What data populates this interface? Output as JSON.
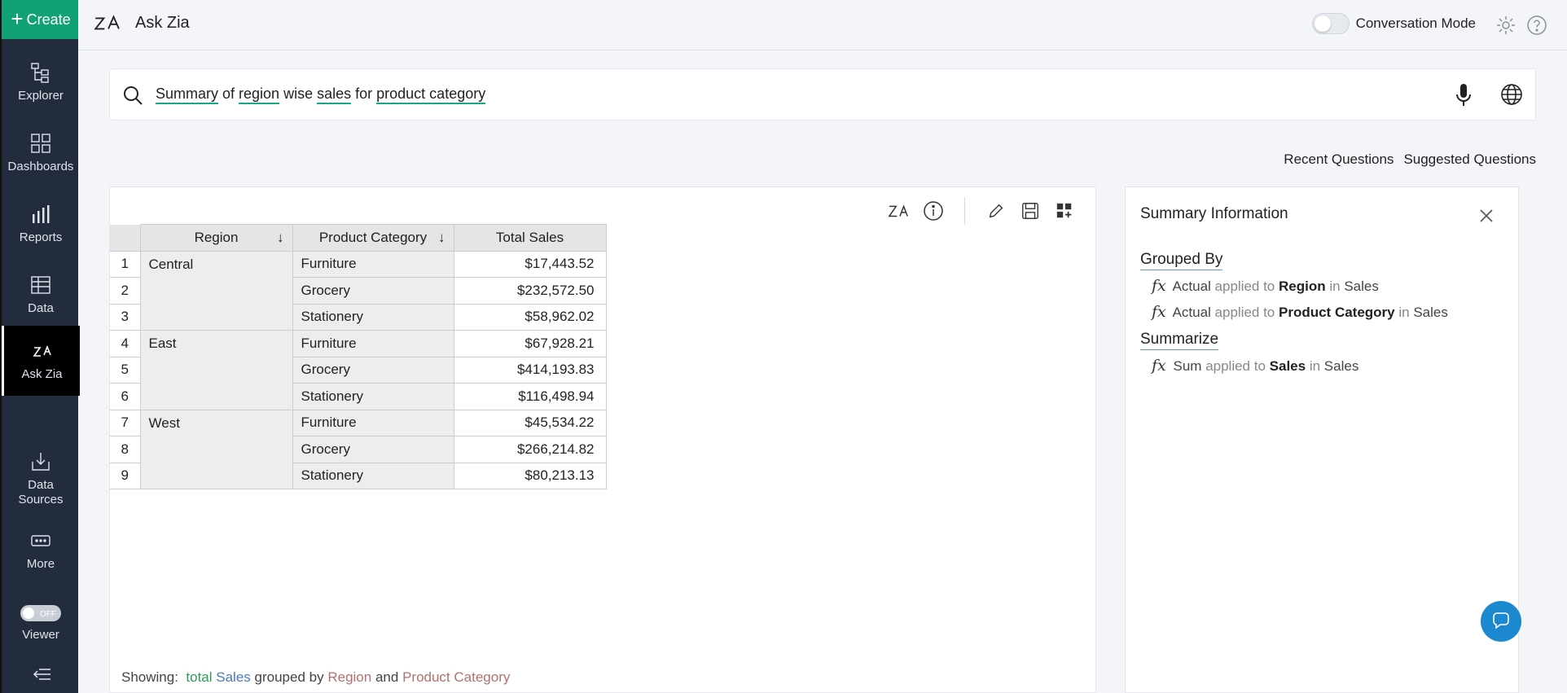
{
  "sidebar": {
    "create_label": "Create",
    "items": [
      {
        "label": "Explorer",
        "icon": "explorer-icon"
      },
      {
        "label": "Dashboards",
        "icon": "dashboards-icon"
      },
      {
        "label": "Reports",
        "icon": "reports-icon"
      },
      {
        "label": "Data",
        "icon": "data-icon"
      },
      {
        "label": "Ask Zia",
        "icon": "zia-icon",
        "active": true
      },
      {
        "label": "Data\nSources",
        "icon": "data-sources-icon"
      },
      {
        "label": "More",
        "icon": "more-icon"
      },
      {
        "label": "Viewer",
        "icon": "viewer-toggle",
        "toggle_text": "OFF"
      }
    ]
  },
  "header": {
    "title": "Ask Zia",
    "conversation_mode_label": "Conversation Mode"
  },
  "search": {
    "tokens": [
      {
        "text": "Summary",
        "underlined": true
      },
      {
        "text": " of ",
        "underlined": false
      },
      {
        "text": "region",
        "underlined": true
      },
      {
        "text": " wise ",
        "underlined": false
      },
      {
        "text": "sales",
        "underlined": true
      },
      {
        "text": " for ",
        "underlined": false
      },
      {
        "text": "product category",
        "underlined": true
      }
    ]
  },
  "links": {
    "recent": "Recent Questions",
    "suggested": "Suggested Questions"
  },
  "table": {
    "headers": [
      "Region",
      "Product Category",
      "Total Sales"
    ],
    "groups": [
      {
        "region": "Central",
        "rows": [
          {
            "num": "1",
            "category": "Furniture",
            "total": "$17,443.52"
          },
          {
            "num": "2",
            "category": "Grocery",
            "total": "$232,572.50"
          },
          {
            "num": "3",
            "category": "Stationery",
            "total": "$58,962.02"
          }
        ]
      },
      {
        "region": "East",
        "rows": [
          {
            "num": "4",
            "category": "Furniture",
            "total": "$67,928.21"
          },
          {
            "num": "5",
            "category": "Grocery",
            "total": "$414,193.83"
          },
          {
            "num": "6",
            "category": "Stationery",
            "total": "$116,498.94"
          }
        ]
      },
      {
        "region": "West",
        "rows": [
          {
            "num": "7",
            "category": "Furniture",
            "total": "$45,534.22"
          },
          {
            "num": "8",
            "category": "Grocery",
            "total": "$266,214.82"
          },
          {
            "num": "9",
            "category": "Stationery",
            "total": "$80,213.13"
          }
        ]
      }
    ]
  },
  "showing": {
    "prefix": "Showing:",
    "w1": "total",
    "w2": "Sales",
    "w3": "grouped by",
    "w4": "Region",
    "w5": "and",
    "w6": "Product Category"
  },
  "summary": {
    "title": "Summary Information",
    "grouped_by_label": "Grouped By",
    "summarize_label": "Summarize",
    "fx": "fx",
    "lines": [
      {
        "func": "Actual",
        "applied": "applied to",
        "field": "Region",
        "in": "in",
        "table": "Sales"
      },
      {
        "func": "Actual",
        "applied": "applied to",
        "field": "Product Category",
        "in": "in",
        "table": "Sales"
      },
      {
        "func": "Sum",
        "applied": "applied to",
        "field": "Sales",
        "in": "in",
        "table": "Sales"
      }
    ]
  },
  "colors": {
    "accent_green": "#12a176",
    "sidebar_bg": "#232c3d",
    "fab_blue": "#1b88d0"
  }
}
